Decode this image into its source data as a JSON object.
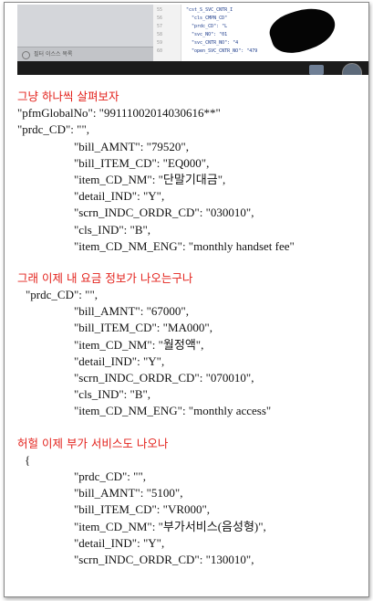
{
  "screenshot_strip": {
    "sidebar_label": "필터 이스스 목록",
    "code_lines": [
      {
        "no": "55",
        "text": "\"cst_S_SVC_CNTR_I"
      },
      {
        "no": "56",
        "text": "  \"cls_CMPN_CD\""
      },
      {
        "no": "57",
        "text": "  \"prdc_CD\": \"L"
      },
      {
        "no": "58",
        "text": "  \"svc_NO\": \"01"
      },
      {
        "no": "59",
        "text": "  \"svc_CNTR_NO\": \"4"
      },
      {
        "no": "60",
        "text": "  \"open_SVC_CNTR_NO\": \"479"
      }
    ]
  },
  "sections": [
    {
      "note": "그냥 하나씩 살펴보자",
      "lines": [
        {
          "indent": 0,
          "text": "\"pfmGlobalNo\": \"99111002014030616**\""
        },
        {
          "indent": 0,
          "text": "\"prdc_CD\": \"\","
        },
        {
          "indent": 62,
          "text": "\"bill_AMNT\": \"79520\","
        },
        {
          "indent": 62,
          "text": "\"bill_ITEM_CD\": \"EQ000\","
        },
        {
          "indent": 62,
          "text": "\"item_CD_NM\": \"단말기대금\","
        },
        {
          "indent": 62,
          "text": "\"detail_IND\": \"Y\","
        },
        {
          "indent": 62,
          "text": "\"scrn_INDC_ORDR_CD\": \"030010\","
        },
        {
          "indent": 62,
          "text": "\"cls_IND\": \"B\","
        },
        {
          "indent": 62,
          "text": "\"item_CD_NM_ENG\": \"monthly handset fee\""
        }
      ]
    },
    {
      "note": "그래 이제 내 요금 정보가 나오는구나",
      "lines": [
        {
          "indent": 9,
          "text": "\"prdc_CD\": \"\","
        },
        {
          "indent": 62,
          "text": "\"bill_AMNT\": \"67000\","
        },
        {
          "indent": 62,
          "text": "\"bill_ITEM_CD\": \"MA000\","
        },
        {
          "indent": 62,
          "text": "\"item_CD_NM\": \"월정액\","
        },
        {
          "indent": 62,
          "text": "\"detail_IND\": \"Y\","
        },
        {
          "indent": 62,
          "text": "\"scrn_INDC_ORDR_CD\": \"070010\","
        },
        {
          "indent": 62,
          "text": "\"cls_IND\": \"B\","
        },
        {
          "indent": 62,
          "text": "\"item_CD_NM_ENG\": \"monthly access\""
        }
      ]
    },
    {
      "note": "허헐 이제 부가 서비스도 나오나",
      "lines": [
        {
          "indent": 8,
          "text": "{"
        },
        {
          "indent": 62,
          "text": "\"prdc_CD\": \"\","
        },
        {
          "indent": 62,
          "text": "\"bill_AMNT\": \"5100\","
        },
        {
          "indent": 62,
          "text": "\"bill_ITEM_CD\": \"VR000\","
        },
        {
          "indent": 62,
          "text": "\"item_CD_NM\": \"부가서비스(음성형)\","
        },
        {
          "indent": 62,
          "text": "\"detail_IND\": \"Y\","
        },
        {
          "indent": 62,
          "text": "\"scrn_INDC_ORDR_CD\": \"130010\","
        }
      ]
    }
  ]
}
